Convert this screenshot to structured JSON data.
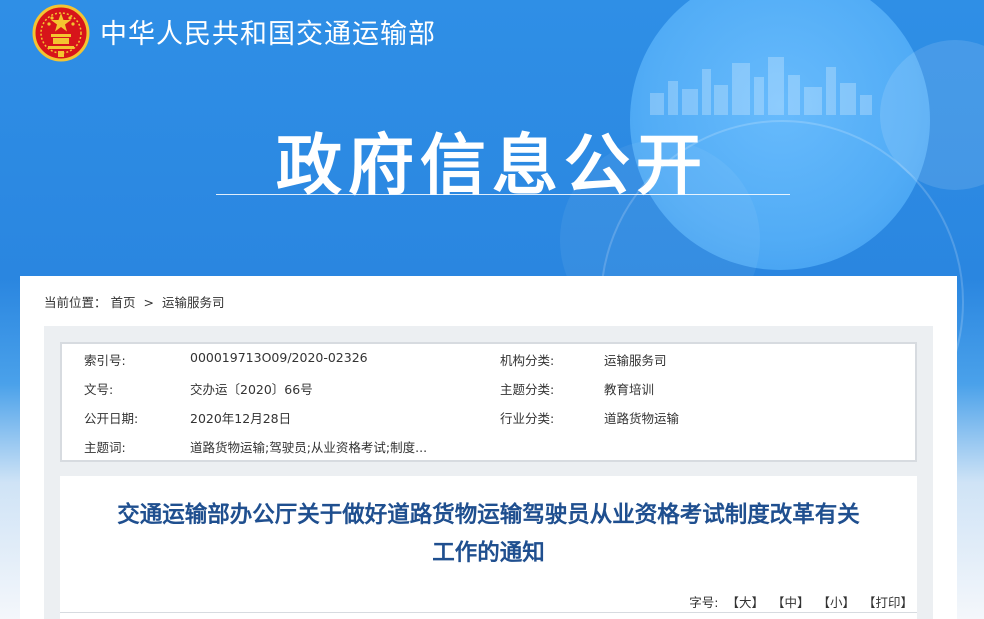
{
  "header": {
    "site_title": "中华人民共和国交通运输部",
    "section_title": "政府信息公开"
  },
  "breadcrumb": {
    "prefix": "当前位置：",
    "items": [
      "首页",
      "运输服务司"
    ],
    "separator": ">"
  },
  "meta": {
    "rows": [
      {
        "k1": "索引号:",
        "v1": "000019713O09/2020-02326",
        "k2": "机构分类:",
        "v2": "运输服务司"
      },
      {
        "k1": "文号:",
        "v1": "交办运〔2020〕66号",
        "k2": "主题分类:",
        "v2": "教育培训"
      },
      {
        "k1": "公开日期:",
        "v1": "2020年12月28日",
        "k2": "行业分类:",
        "v2": "道路货物运输"
      },
      {
        "k1": "主题词:",
        "v1": "道路货物运输;驾驶员;从业资格考试;制度...",
        "k2": "",
        "v2": ""
      }
    ]
  },
  "document": {
    "title_line1": "交通运输部办公厅关于做好道路货物运输驾驶员从业资格考试制度改革有关",
    "title_line2": "工作的通知"
  },
  "font_controls": {
    "label": "字号:",
    "large": "【大】",
    "medium": "【中】",
    "small": "【小】",
    "print": "【打印】"
  },
  "colors": {
    "banner_blue": "#2a86e0",
    "title_blue": "#1f4f8f",
    "emblem_red": "#d7141a",
    "emblem_gold": "#f4c430"
  }
}
